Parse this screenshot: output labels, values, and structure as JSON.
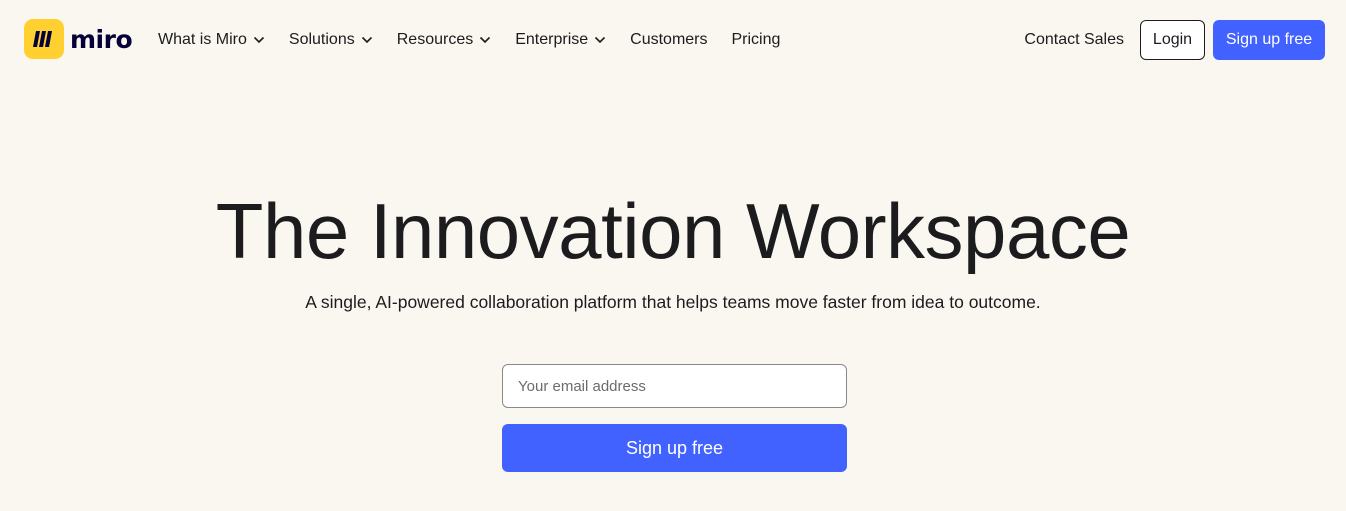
{
  "header": {
    "logo_text": "miro",
    "nav": [
      {
        "label": "What is Miro",
        "has_dropdown": true
      },
      {
        "label": "Solutions",
        "has_dropdown": true
      },
      {
        "label": "Resources",
        "has_dropdown": true
      },
      {
        "label": "Enterprise",
        "has_dropdown": true
      },
      {
        "label": "Customers",
        "has_dropdown": false
      },
      {
        "label": "Pricing",
        "has_dropdown": false
      }
    ],
    "contact_label": "Contact Sales",
    "login_label": "Login",
    "signup_label": "Sign up free"
  },
  "hero": {
    "title": "The Innovation Workspace",
    "subtitle": "A single, AI-powered collaboration platform that helps teams move faster from idea to outcome.",
    "email_placeholder": "Your email address",
    "email_value": "",
    "signup_label": "Sign up free"
  },
  "colors": {
    "background": "#FAF6F0",
    "brand_yellow": "#FFD02F",
    "primary_blue": "#4262FF",
    "text": "#1C1C1E"
  },
  "icons": {
    "logo": "miro-logo-icon",
    "dropdown": "chevron-down-icon"
  }
}
